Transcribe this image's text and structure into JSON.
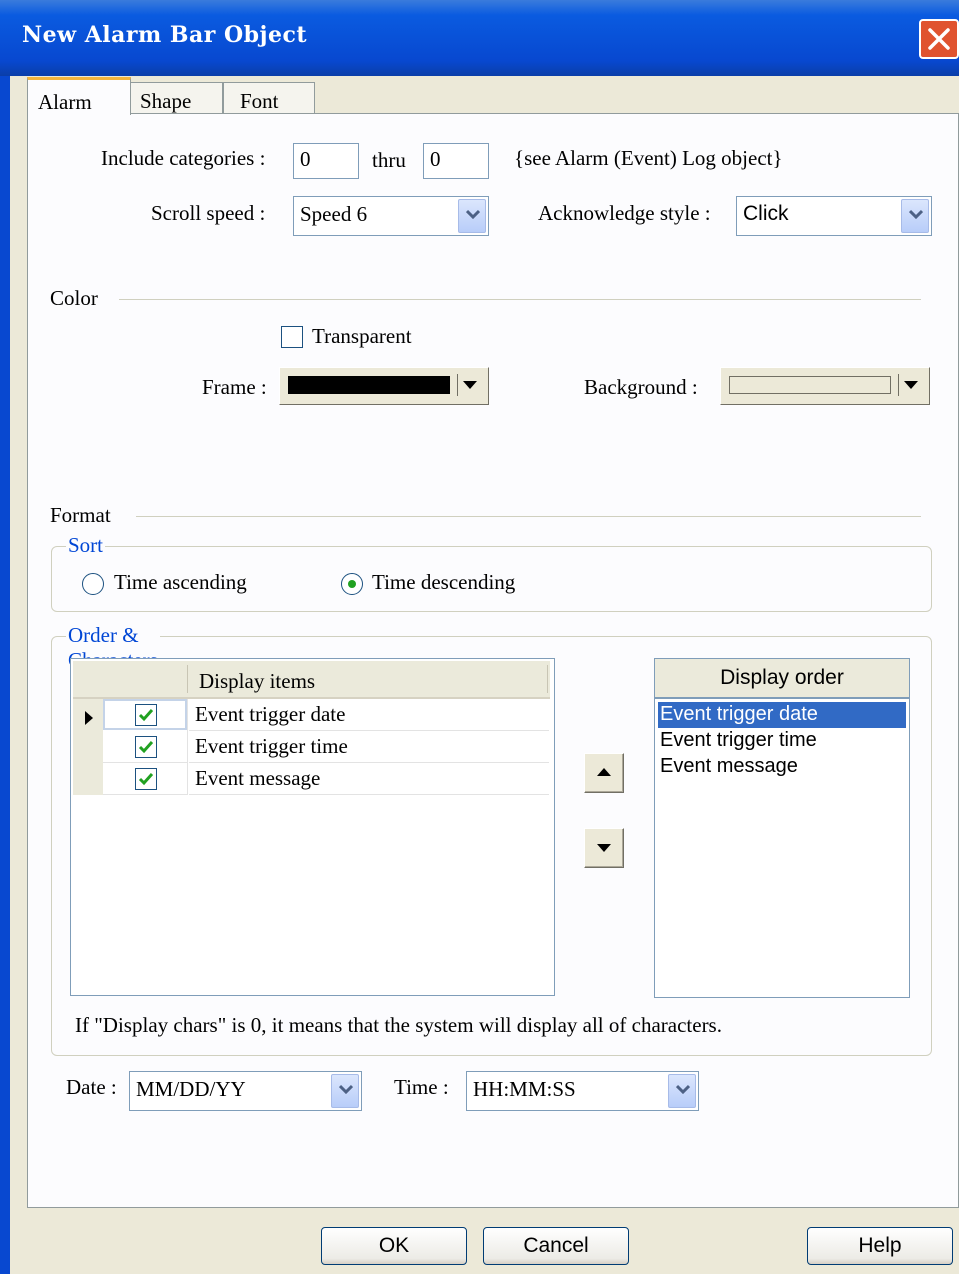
{
  "window": {
    "title": "New  Alarm Bar Object"
  },
  "tabs": [
    {
      "label": "Alarm"
    },
    {
      "label": "Shape"
    },
    {
      "label": "Font"
    }
  ],
  "alarm": {
    "include_categories_label": "Include categories :",
    "category_from": "0",
    "thru_label": "thru",
    "category_to": "0",
    "categories_note": "{see Alarm (Event) Log object}",
    "scroll_speed_label": "Scroll  speed :",
    "scroll_speed_value": "Speed 6",
    "ack_style_label": "Acknowledge style :",
    "ack_style_value": "Click"
  },
  "color": {
    "section_label": "Color",
    "transparent_label": "Transparent",
    "transparent_checked": false,
    "frame_label": "Frame :",
    "frame_color": "#000000",
    "background_label": "Background :",
    "background_color": "#ece9d8"
  },
  "format": {
    "section_label": "Format",
    "sort": {
      "group_label": "Sort",
      "ascending_label": "Time ascending",
      "descending_label": "Time descending",
      "selected": "descending"
    },
    "order": {
      "group_label": "Order & Characters",
      "grid_header": "Display items",
      "items": [
        {
          "label": "Event trigger date",
          "checked": true
        },
        {
          "label": "Event trigger time",
          "checked": true
        },
        {
          "label": "Event message",
          "checked": true
        }
      ],
      "display_order_header": "Display order",
      "display_order": [
        "Event trigger date",
        "Event trigger time",
        "Event message"
      ],
      "selected_index": 0,
      "note": "If \"Display chars\" is 0, it means that the system will display all of  characters."
    }
  },
  "date_time": {
    "date_label": "Date :",
    "date_value": "MM/DD/YY",
    "time_label": "Time :",
    "time_value": "HH:MM:SS"
  },
  "buttons": {
    "ok": "OK",
    "cancel": "Cancel",
    "help": "Help"
  }
}
